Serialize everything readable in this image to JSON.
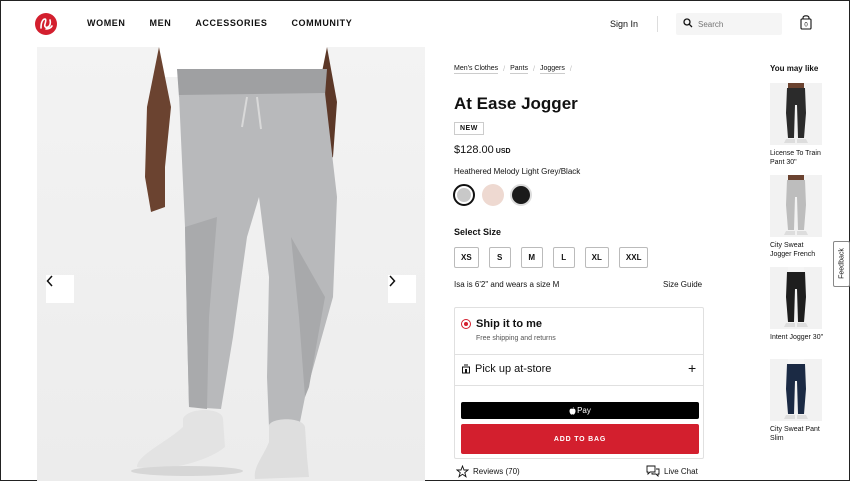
{
  "header": {
    "logo_icon": "lululemon-logo-icon",
    "nav": [
      "WOMEN",
      "MEN",
      "ACCESSORIES",
      "COMMUNITY"
    ],
    "sign_in": "Sign In",
    "search_placeholder": "Search",
    "bag_count": "0"
  },
  "breadcrumbs": [
    "Men's Clothes",
    "Pants",
    "Joggers"
  ],
  "product": {
    "title": "At Ease Jogger",
    "badge": "NEW",
    "price": "$128.00",
    "currency": "USD",
    "color_name": "Heathered Melody Light Grey/Black",
    "swatches": [
      "#c8c8c8",
      "#eed9d1",
      "#1a1a1a"
    ],
    "size_label": "Select Size",
    "sizes": [
      "XS",
      "S",
      "M",
      "L",
      "XL",
      "XXL"
    ],
    "fit_note": "Isa is 6'2\" and wears a size M",
    "size_guide": "Size Guide"
  },
  "delivery": {
    "ship_title": "Ship it to me",
    "ship_sub": "Free shipping and returns",
    "pickup_title": "Pick up at-store",
    "apple_pay": "Pay",
    "add_to_bag": "ADD TO BAG"
  },
  "reviews": "Reviews (70)",
  "live_chat": "Live Chat",
  "you_may_like": {
    "title": "You may like",
    "items": [
      {
        "name": "License To Train Pant 30\"",
        "color": "#2b2b2b"
      },
      {
        "name": "City Sweat Jogger French",
        "color": "#bdbdbd"
      },
      {
        "name": "Intent Jogger 30\"",
        "color": "#1e1e1e"
      },
      {
        "name": "City Sweat Pant Slim",
        "color": "#1b2a44"
      }
    ]
  },
  "feedback": "Feedback",
  "colors": {
    "brand_red": "#d31f2e"
  }
}
